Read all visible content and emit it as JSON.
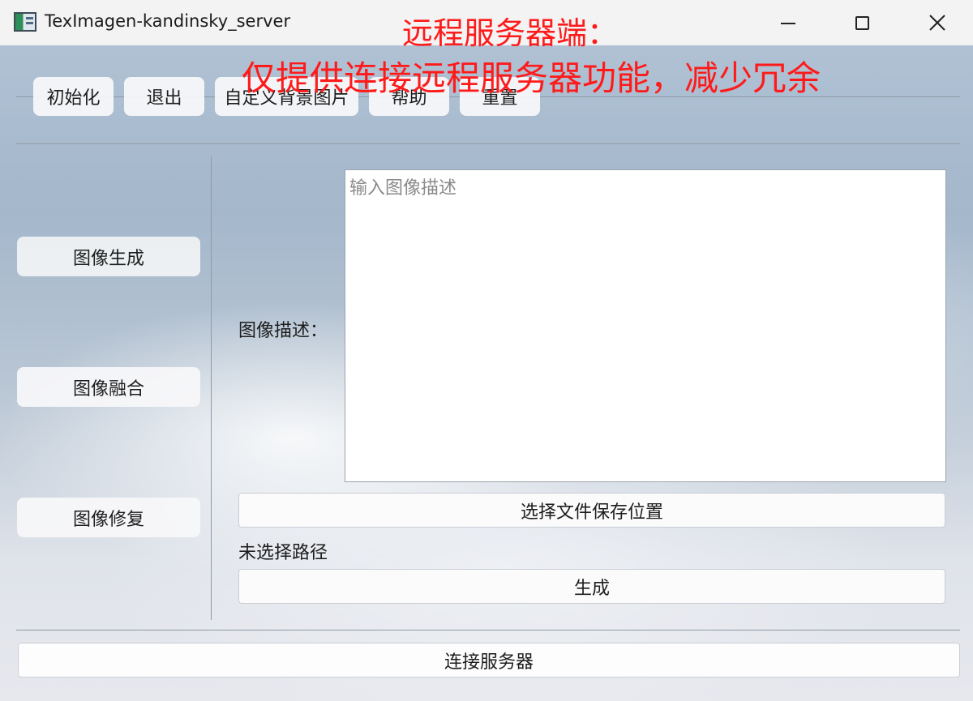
{
  "window": {
    "title": "TexImagen-kandinsky_server"
  },
  "annotation": {
    "line1": "远程服务器端：",
    "line2": "仅提供连接远程服务器功能，减少冗余",
    "color": "#ff1a1a"
  },
  "toolbar": {
    "init_label": "初始化",
    "exit_label": "退出",
    "custom_bg_label": "自定义背景图片",
    "help_label": "帮助",
    "reset_label": "重置"
  },
  "sidebar": {
    "items": [
      {
        "label": "图像生成",
        "selected": true
      },
      {
        "label": "图像融合",
        "selected": false
      },
      {
        "label": "图像修复",
        "selected": false
      }
    ]
  },
  "main": {
    "description_label": "图像描述：",
    "description_value": "",
    "description_placeholder": "输入图像描述",
    "select_save_label": "选择文件保存位置",
    "path_status": "未选择路径",
    "generate_label": "生成"
  },
  "footer": {
    "connect_label": "连接服务器"
  }
}
